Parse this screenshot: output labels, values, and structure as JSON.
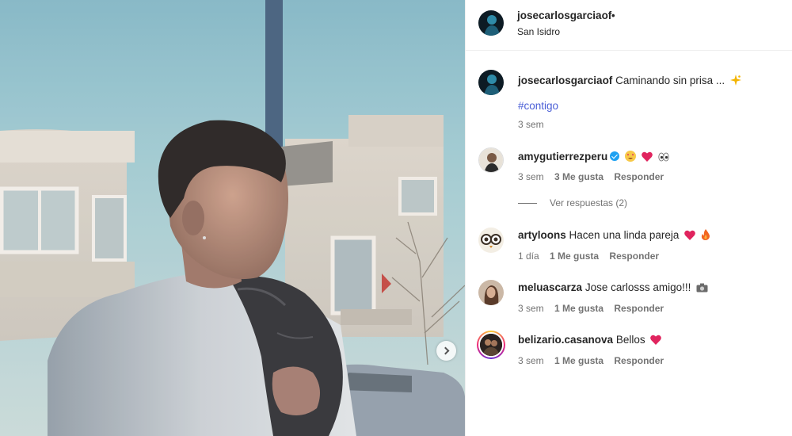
{
  "post": {
    "username": "josecarlosgarciaof",
    "dot": "•",
    "location": "San Isidro"
  },
  "caption": {
    "username": "josecarlosgarciaof",
    "text": "Caminando sin prisa ...",
    "hashtag": "#contigo",
    "time": "3 sem"
  },
  "comments": [
    {
      "username": "amygutierrezperu",
      "verified": true,
      "text": "",
      "time": "3 sem",
      "likes": "3 Me gusta",
      "reply": "Responder"
    },
    {
      "username": "artyloons",
      "text": "Hacen una linda pareja",
      "time": "1 día",
      "likes": "1 Me gusta",
      "reply": "Responder"
    },
    {
      "username": "meluascarza",
      "text": "Jose carlosss amigo!!!",
      "time": "3 sem",
      "likes": "1 Me gusta",
      "reply": "Responder"
    },
    {
      "username": "belizario.casanova",
      "text": "Bellos",
      "time": "3 sem",
      "likes": "1 Me gusta",
      "reply": "Responder"
    }
  ],
  "replies_label": "Ver respuestas (2)",
  "icons": {
    "next": "chevron-right-icon",
    "verified": "verified-badge-icon",
    "sparkle": "sparkles-icon",
    "heart": "heart-icon",
    "heart_eyes": "heart-eyes-icon",
    "eyes": "eyes-icon",
    "fire": "fire-icon",
    "camera": "camera-icon"
  },
  "colors": {
    "hashtag": "#4a5ed6",
    "heart": "#e0245e",
    "verified": "#1da1f2",
    "muted": "#737373"
  }
}
